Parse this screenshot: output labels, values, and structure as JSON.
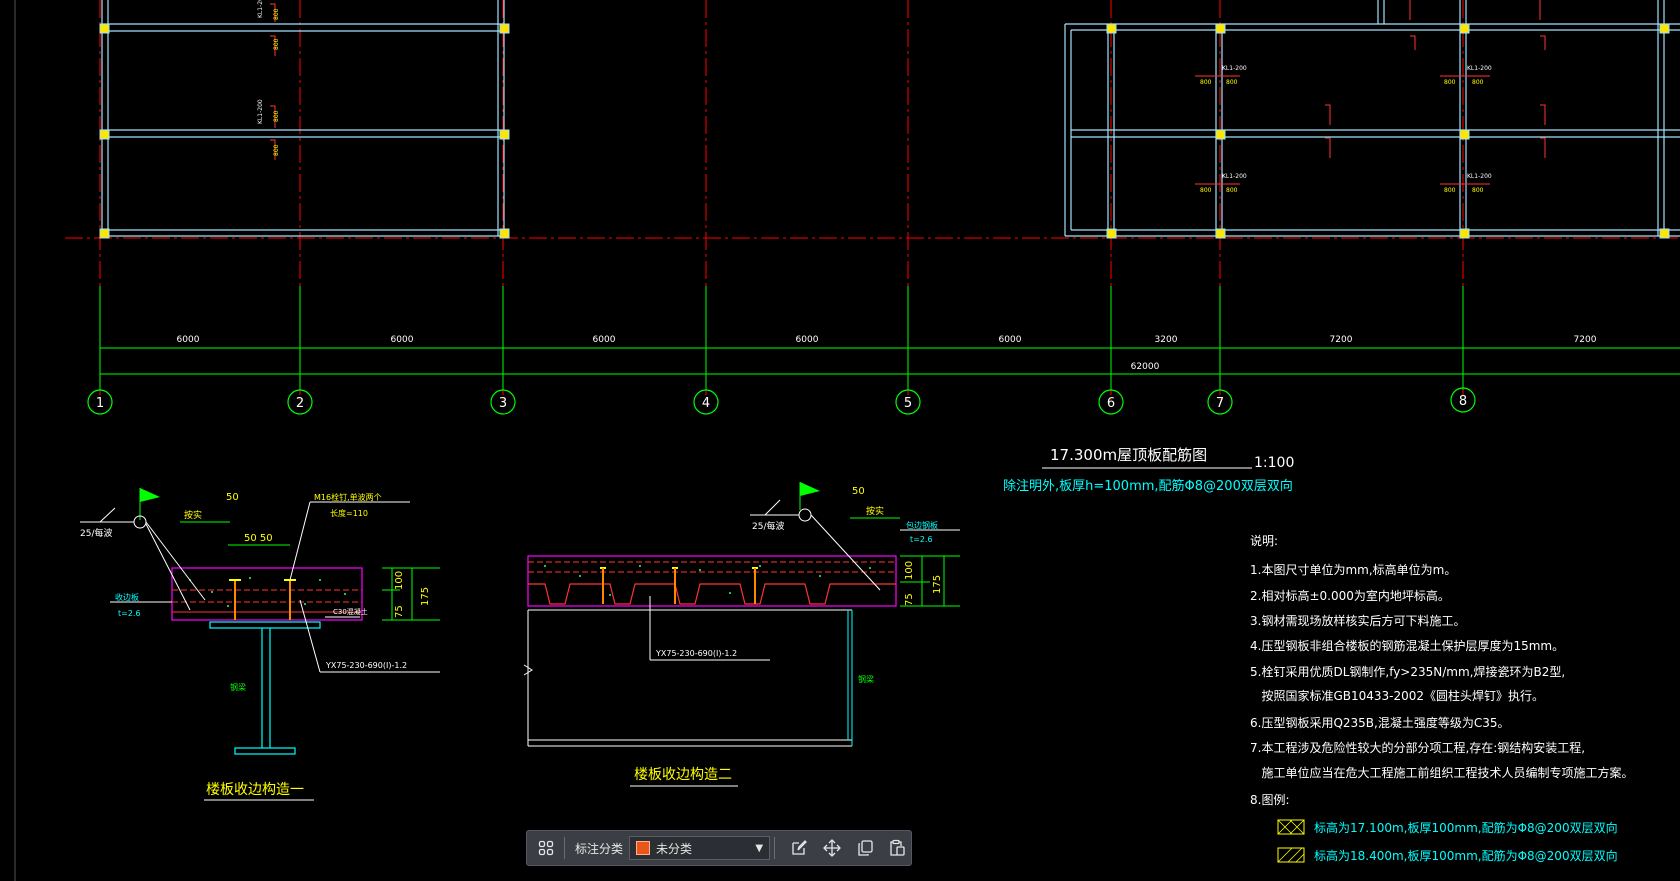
{
  "grid": {
    "axes": [
      "1",
      "2",
      "3",
      "4",
      "5",
      "6",
      "7",
      "8"
    ],
    "spans": [
      "6000",
      "6000",
      "6000",
      "6000",
      "6000",
      "3200",
      "7200",
      "7200"
    ],
    "total": "62000"
  },
  "plan_labels": {
    "beam_a": "KL1-200",
    "dim_800": "800"
  },
  "drawing": {
    "title": "17.300m屋顶板配筋图",
    "scale": "1:100",
    "note": "除注明外,板厚h=100mm,配筋Φ8@200双层双向"
  },
  "detail1": {
    "title": "楼板收边构造一",
    "weld": "25/每波",
    "dim_50": "50",
    "dim_50_50": "50  50",
    "label_anchor": "按实",
    "label_studs": "M16栓钉,单波两个",
    "label_stud_len": "长度=110",
    "label_edge": "收边板",
    "label_edge_t": "t=2.6",
    "label_concrete": "C30混凝土",
    "label_deck": "YX75-230-690(I)-1.2",
    "label_beam": "钢梁",
    "dim_75": "75",
    "dim_100": "100",
    "dim_175": "175"
  },
  "detail2": {
    "title": "楼板收边构造二",
    "weld": "25/每波",
    "dim_50": "50",
    "label_anchor": "按实",
    "label_edge": "包边钢板",
    "label_edge_t": "t=2.6",
    "label_deck": "YX75-230-690(I)-1.2",
    "label_beam": "钢梁",
    "dim_75": "75",
    "dim_100": "100",
    "dim_175": "175"
  },
  "notes": {
    "heading": "说明:",
    "items": [
      "1.本图尺寸单位为mm,标高单位为m。",
      "2.相对标高±0.000为室内地坪标高。",
      "3.钢材需现场放样核实后方可下料施工。",
      "4.压型钢板非组合楼板的钢筋混凝土保护层厚度为15mm。",
      "5.栓钉采用优质DL钢制作,fy>235N/mm,焊接瓷环为B2型,",
      "   按照国家标准GB10433-2002《圆柱头焊钉》执行。",
      "6.压型钢板采用Q235B,混凝土强度等级为C35。",
      "7.本工程涉及危险性较大的分部分项工程,存在:钢结构安装工程,",
      "   施工单位应当在危大工程施工前组织工程技术人员编制专项施工方案。",
      "8.图例:"
    ],
    "legend": [
      "标高为17.100m,板厚100mm,配筋为Φ8@200双层双向",
      "标高为18.400m,板厚100mm,配筋为Φ8@200双层双向"
    ]
  },
  "toolbar": {
    "label": "标注分类",
    "selected": "未分类"
  },
  "colors": {
    "background": "#000000",
    "grid_axis": "#ff0000",
    "dimension": "#00ff00",
    "beam": "#9fe3ff",
    "column": "#ffff00",
    "detail": "#ff00ff",
    "text_white": "#ffffff",
    "text_cyan": "#00ffff",
    "text_yellow": "#ffff00",
    "toolbar_bg": "#3b3f45"
  }
}
